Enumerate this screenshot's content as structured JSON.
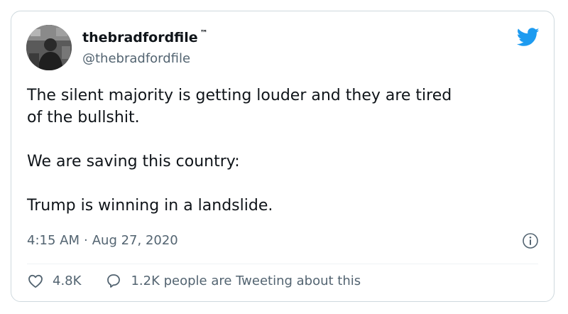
{
  "tweet": {
    "display_name": "thebradfordfile",
    "name_badge": "™",
    "handle": "@thebradfordfile",
    "lines": [
      "The silent majority is getting louder and they are tired",
      "of the bullshit.",
      "",
      "We are saving this country:",
      "",
      "Trump is winning in a landslide."
    ],
    "time": "4:15 AM",
    "separator": "·",
    "date": "Aug 27, 2020",
    "likes": "4.8K",
    "talk": "1.2K people are Tweeting about this"
  },
  "icons": {
    "brand": "twitter-bird-icon",
    "info": "info-icon",
    "like": "heart-icon",
    "reply": "speech-bubble-icon"
  },
  "colors": {
    "brand": "#1d9bf0",
    "secondary_text": "#536471",
    "border": "#cfd9de"
  }
}
